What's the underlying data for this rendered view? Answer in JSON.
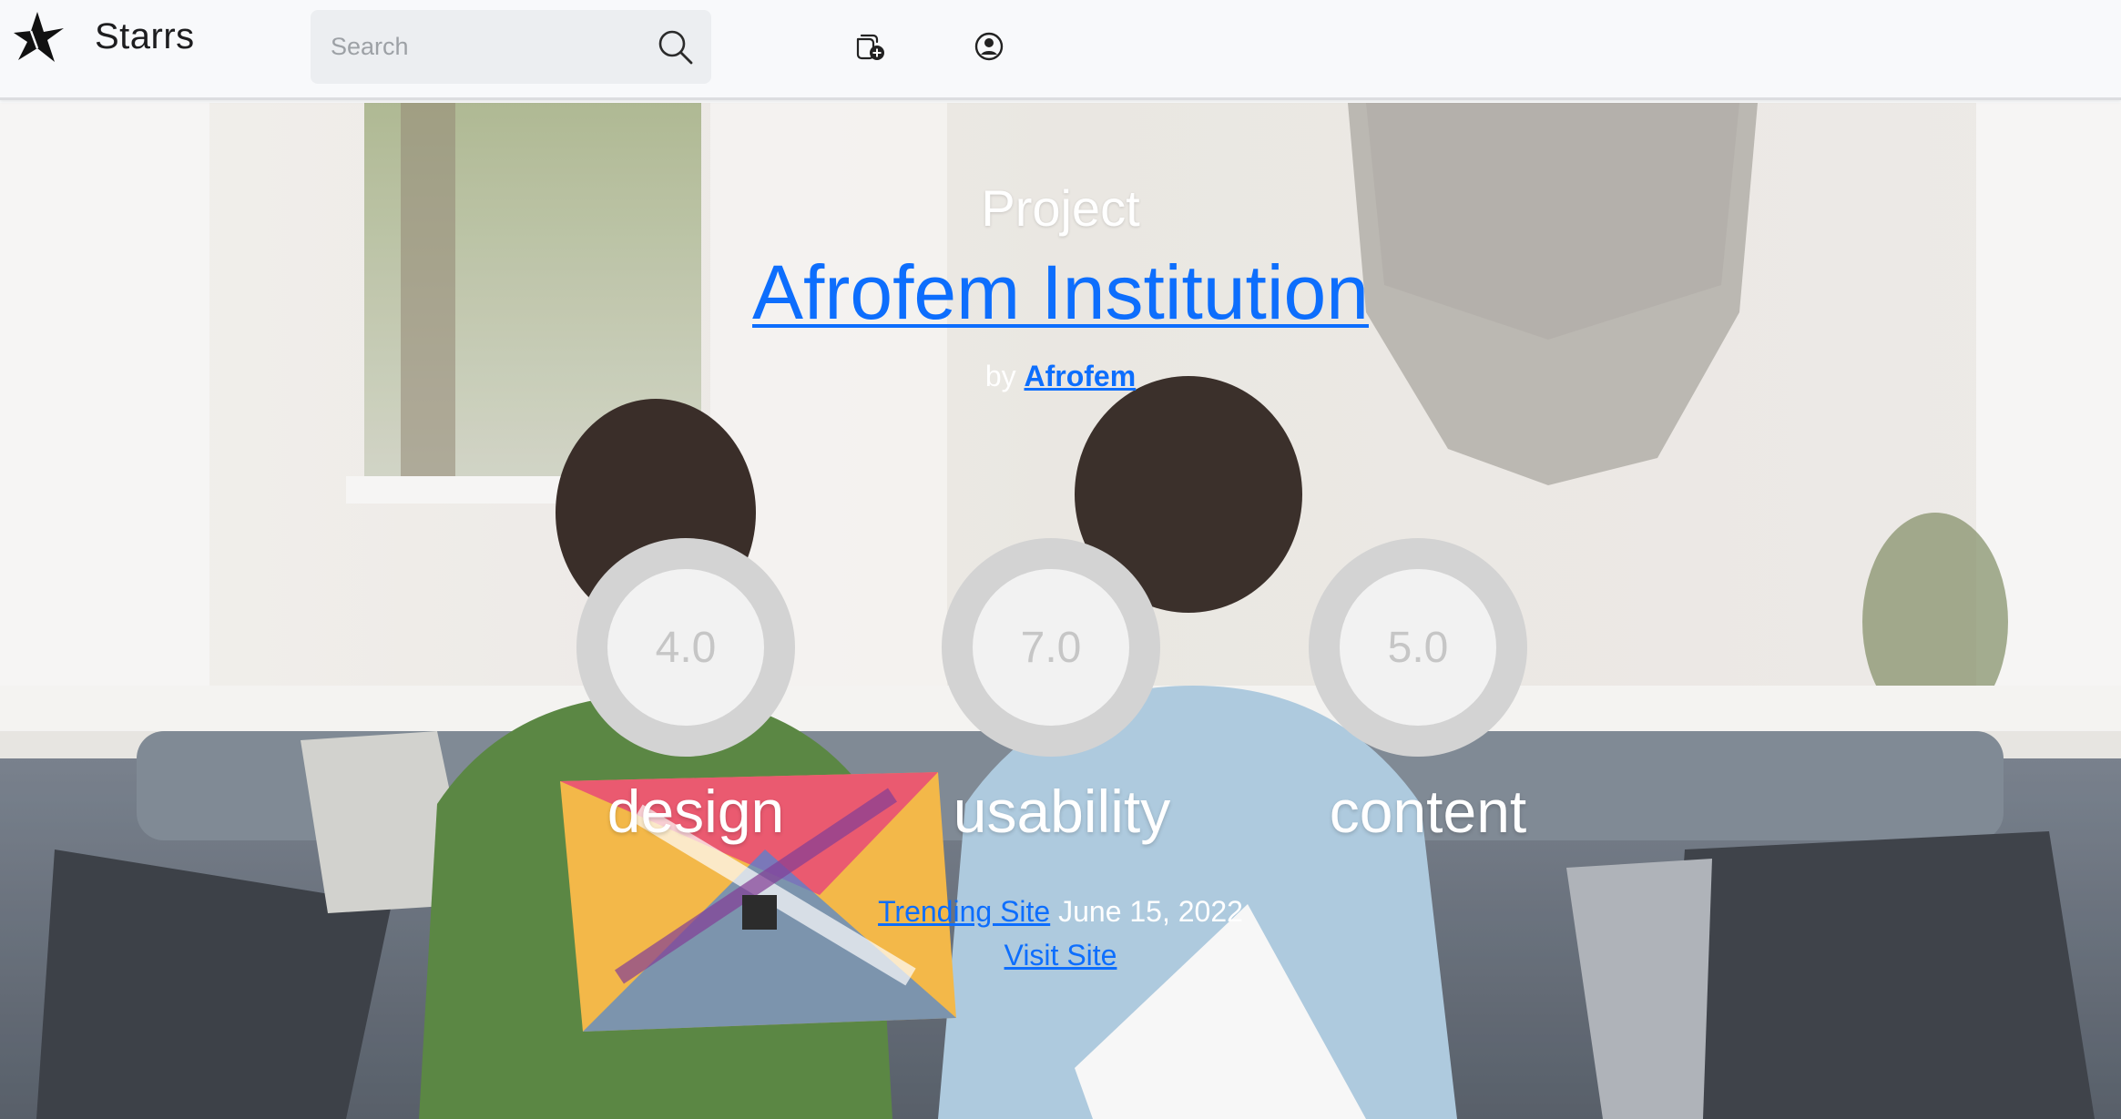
{
  "navbar": {
    "brand_name": "Starrs",
    "search": {
      "placeholder": "Search",
      "value": ""
    },
    "icons": [
      "star-logo-icon",
      "search-icon",
      "add-site-icon",
      "account-circle-icon"
    ]
  },
  "hero": {
    "eyebrow": "Project",
    "title": "Afrofem Institution",
    "by_prefix": "by",
    "author": "Afrofem",
    "scores": [
      {
        "label": "design",
        "value": "4.0"
      },
      {
        "label": "usability",
        "value": "7.0"
      },
      {
        "label": "content",
        "value": "5.0"
      }
    ],
    "badge": "Trending Site",
    "date": "June 15, 2022",
    "visit_label": "Visit Site"
  },
  "colors": {
    "link": "#0d6efd",
    "score_ring": "#d3d3d3",
    "score_inner": "#f2f2f2",
    "score_text": "#c6c6c6"
  }
}
